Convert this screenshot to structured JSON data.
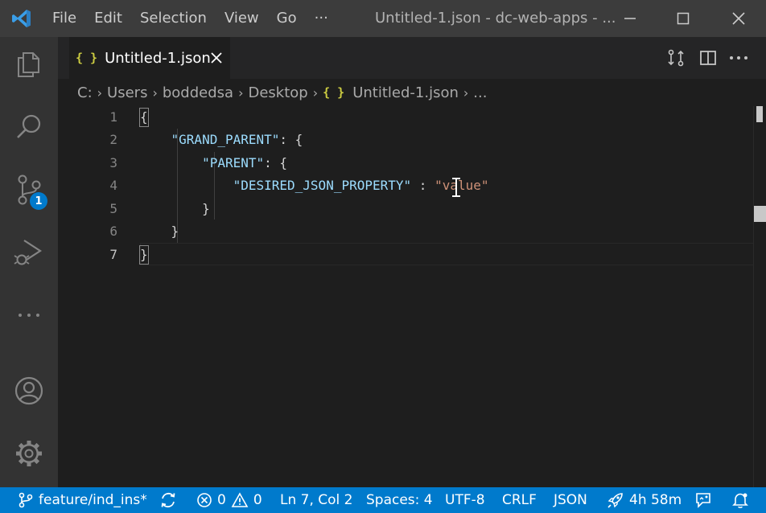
{
  "titlebar": {
    "menu": [
      "File",
      "Edit",
      "Selection",
      "View",
      "Go",
      "···"
    ],
    "window_title": "Untitled-1.json - dc-web-apps - ...",
    "controls": [
      "minimize-icon",
      "maximize-icon",
      "close-icon"
    ]
  },
  "activitybar": {
    "items": [
      "explorer-icon",
      "search-icon",
      "source-control-icon",
      "run-debug-icon",
      "more-icon"
    ],
    "scm_badge": "1",
    "bottom": [
      "account-icon",
      "settings-gear-icon"
    ]
  },
  "tab": {
    "icon": "{ }",
    "label": "Untitled-1.json"
  },
  "breadcrumb": {
    "parts": [
      "C:",
      "Users",
      "boddedsa",
      "Desktop"
    ],
    "file_icon": "{ }",
    "file": "Untitled-1.json",
    "ellipsis": "..."
  },
  "editor": {
    "line_numbers": [
      "1",
      "2",
      "3",
      "4",
      "5",
      "6",
      "7"
    ],
    "lines": [
      {
        "indent": "",
        "key": "",
        "sep": "",
        "open": "{",
        "val": ""
      },
      {
        "indent": "    ",
        "key": "\"GRAND_PARENT\"",
        "sep": ": ",
        "open": "{",
        "val": ""
      },
      {
        "indent": "        ",
        "key": "\"PARENT\"",
        "sep": ": ",
        "open": "{",
        "val": ""
      },
      {
        "indent": "            ",
        "key": "\"DESIRED_JSON_PROPERTY\"",
        "sep": " : ",
        "open": "",
        "val": "\"value\""
      },
      {
        "indent": "        ",
        "key": "",
        "sep": "",
        "open": "}",
        "val": ""
      },
      {
        "indent": "    ",
        "key": "",
        "sep": "",
        "open": "}",
        "val": ""
      },
      {
        "indent": "",
        "key": "",
        "sep": "",
        "open": "}",
        "val": ""
      }
    ],
    "active_line": "7"
  },
  "statusbar": {
    "branch": "feature/ind_ins*",
    "errors": "0",
    "warnings": "0",
    "position": "Ln 7, Col 2",
    "spaces": "Spaces: 4",
    "encoding": "UTF-8",
    "eol": "CRLF",
    "language": "JSON",
    "timer": "4h 58m"
  },
  "colors": {
    "accent": "#007acc",
    "key": "#9cdcfe",
    "string": "#ce9178",
    "json_icon": "#cbcb41"
  }
}
